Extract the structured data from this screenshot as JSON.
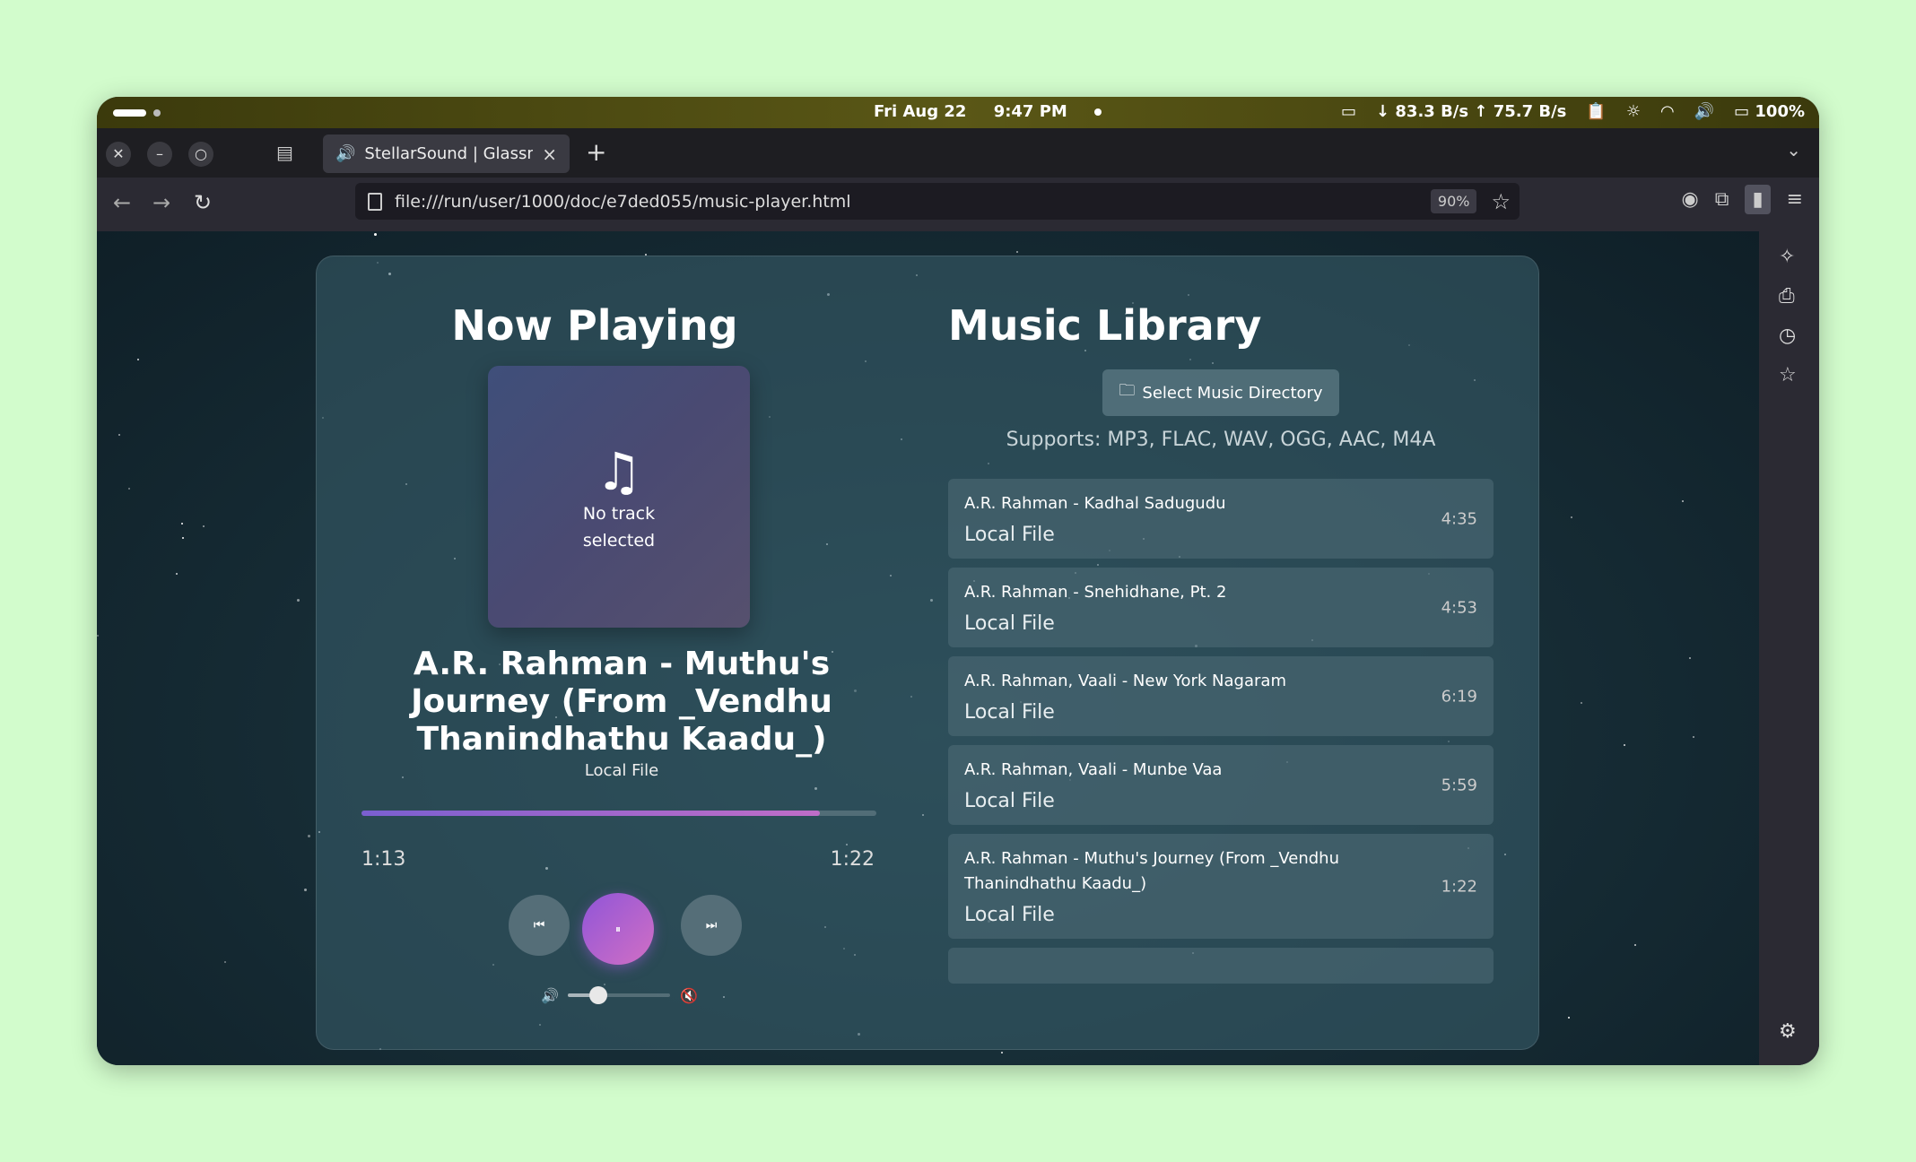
{
  "system": {
    "date": "Fri Aug 22",
    "time": "9:47 PM",
    "network": "↓ 83.3 B/s ↑ 75.7 B/s",
    "battery": "100%"
  },
  "browser": {
    "tab_title": "StellarSound | Glassmorp",
    "url": "file:///run/user/1000/doc/e7ded055/music-player.html",
    "zoom": "90%"
  },
  "player": {
    "heading": "Now Playing",
    "placeholder_text": "No track selected",
    "track_title": "A.R. Rahman - Muthu's Journey (From _Vendhu Thanindhathu Kaadu_)",
    "track_source": "Local File",
    "current_time": "1:13",
    "total_time": "1:22",
    "progress": 0.89,
    "volume": 0.3
  },
  "library": {
    "heading": "Music Library",
    "select_button": "Select Music Directory",
    "supports": "Supports: MP3, FLAC, WAV, OGG, AAC, M4A",
    "tracks": [
      {
        "name": "A.R. Rahman - Kadhal Sadugudu",
        "source": "Local File",
        "duration": "4:35"
      },
      {
        "name": "A.R. Rahman - Snehidhane, Pt. 2",
        "source": "Local File",
        "duration": "4:53"
      },
      {
        "name": "A.R. Rahman, Vaali - New York Nagaram",
        "source": "Local File",
        "duration": "6:19"
      },
      {
        "name": "A.R. Rahman, Vaali - Munbe Vaa",
        "source": "Local File",
        "duration": "5:59"
      },
      {
        "name": "A.R. Rahman - Muthu's Journey (From _Vendhu Thanindhathu Kaadu_)",
        "source": "Local File",
        "duration": "1:22"
      }
    ]
  },
  "colors": {
    "accent_start": "#7a5fd0",
    "accent_end": "#c06dc8",
    "page_background": "#d2fccc"
  }
}
